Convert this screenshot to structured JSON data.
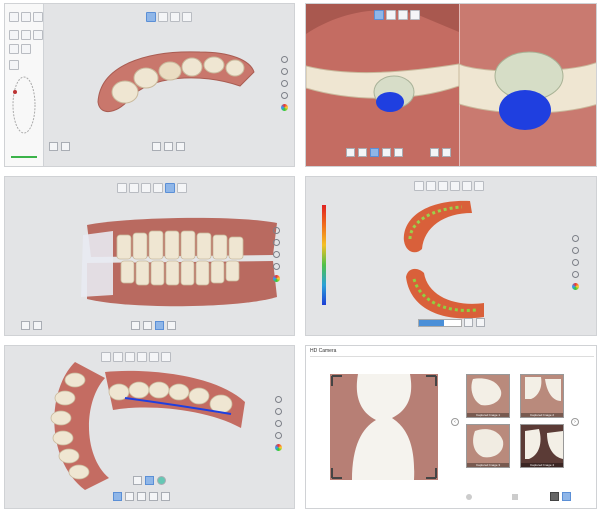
{
  "panels": {
    "camera": {
      "title": "HD Camera",
      "thumbnails": [
        "Captured Image 1",
        "Captured Image 2",
        "Captured Image 3",
        "Captured Image 4"
      ]
    }
  },
  "colors": {
    "accent": "#8fb6e8",
    "gingiva": "#c9776c",
    "tooth": "#efe6d2",
    "preparation_margin": "#1f3fe0",
    "panel_bg": "#e3e4e6"
  },
  "icons": [
    "fit-screen-icon",
    "rotate-icon",
    "zoom-in-icon",
    "zoom-out-icon",
    "color-map-icon",
    "arrow-left-icon",
    "arrow-right-icon",
    "share-icon",
    "trash-icon"
  ]
}
